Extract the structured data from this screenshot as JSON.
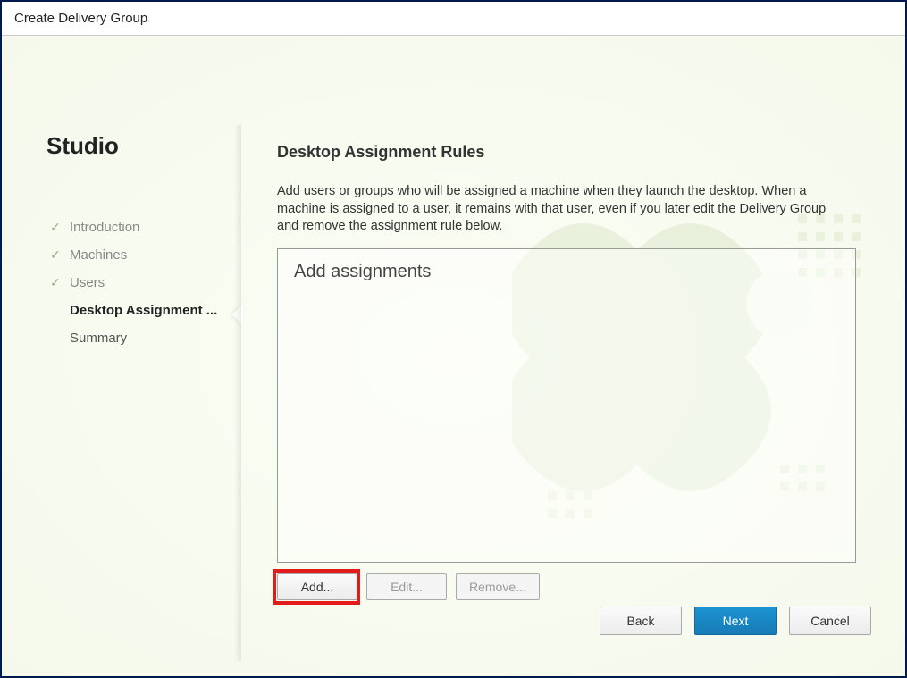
{
  "window": {
    "title": "Create Delivery Group"
  },
  "sidebar": {
    "title": "Studio",
    "steps": [
      {
        "label": "Introduction",
        "state": "done"
      },
      {
        "label": "Machines",
        "state": "done"
      },
      {
        "label": "Users",
        "state": "done"
      },
      {
        "label": "Desktop Assignment ...",
        "state": "current"
      },
      {
        "label": "Summary",
        "state": "pending"
      }
    ]
  },
  "page": {
    "title": "Desktop Assignment Rules",
    "description": "Add users or groups who will be assigned a machine when they launch the desktop. When a machine is assigned to a user, it remains with that user, even if you later edit the Delivery Group and remove the assignment rule below.",
    "listbox_placeholder": "Add assignments",
    "buttons": {
      "add": "Add...",
      "edit": "Edit...",
      "remove": "Remove..."
    }
  },
  "footer": {
    "back": "Back",
    "next": "Next",
    "cancel": "Cancel"
  },
  "highlight": {
    "target": "add-button"
  }
}
